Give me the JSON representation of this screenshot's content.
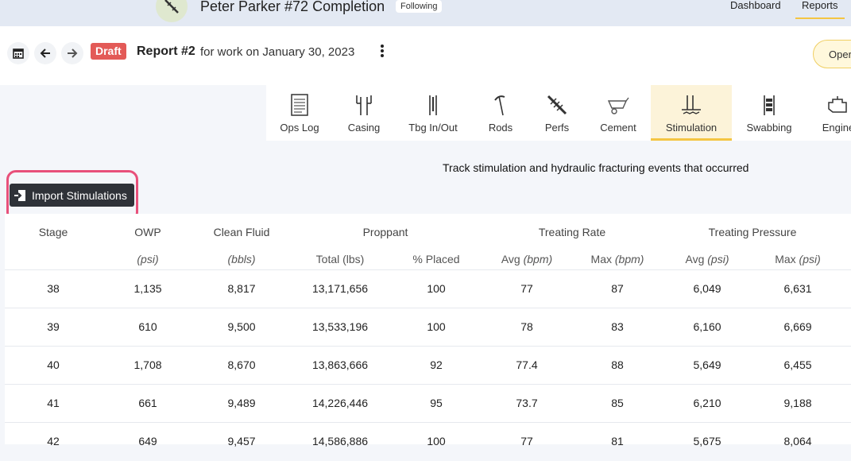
{
  "header": {
    "well_title": "Peter Parker #72 Completion",
    "follow_status": "Following",
    "nav": {
      "dashboard": "Dashboard",
      "reports": "Reports"
    }
  },
  "report": {
    "status": "Draft",
    "title": "Report #2",
    "subtitle": "for work on January 30, 2023",
    "ops_button_label": "Opera"
  },
  "tabs": [
    {
      "label": "Ops Log",
      "icon": "ops-log-icon"
    },
    {
      "label": "Casing",
      "icon": "casing-icon"
    },
    {
      "label": "Tbg In/Out",
      "icon": "tubing-icon"
    },
    {
      "label": "Rods",
      "icon": "rods-icon"
    },
    {
      "label": "Perfs",
      "icon": "perfs-icon"
    },
    {
      "label": "Cement",
      "icon": "cement-icon"
    },
    {
      "label": "Stimulation",
      "icon": "stimulation-icon",
      "active": true
    },
    {
      "label": "Swabbing",
      "icon": "swabbing-icon"
    },
    {
      "label": "Engine",
      "icon": "engine-icon"
    }
  ],
  "description": "Track stimulation and hydraulic fracturing events that occurred",
  "import_button": {
    "label": "Import Stimulations",
    "icon": "import-icon"
  },
  "table": {
    "group_headers": [
      "Stage",
      "OWP",
      "Clean Fluid",
      "Proppant",
      "Treating Rate",
      "Treating Pressure"
    ],
    "sub_headers": {
      "owp": "(psi)",
      "clean_fluid": "(bbls)",
      "proppant_total": "Total (lbs)",
      "proppant_placed": "% Placed",
      "rate_avg_label": "Avg",
      "rate_avg_unit": "(bpm)",
      "rate_max_label": "Max",
      "rate_max_unit": "(bpm)",
      "press_avg_label": "Avg",
      "press_avg_unit": "(psi)",
      "press_max_label": "Max",
      "press_max_unit": "(psi)"
    },
    "rows": [
      [
        "38",
        "1,135",
        "8,817",
        "13,171,656",
        "100",
        "77",
        "87",
        "6,049",
        "6,631"
      ],
      [
        "39",
        "610",
        "9,500",
        "13,533,196",
        "100",
        "78",
        "83",
        "6,160",
        "6,669"
      ],
      [
        "40",
        "1,708",
        "8,670",
        "13,863,666",
        "92",
        "77.4",
        "88",
        "5,649",
        "6,455"
      ],
      [
        "41",
        "661",
        "9,489",
        "14,226,446",
        "95",
        "73.7",
        "85",
        "6,210",
        "9,188"
      ],
      [
        "42",
        "649",
        "9,457",
        "14,586,886",
        "100",
        "77",
        "81",
        "5,675",
        "8,064"
      ]
    ]
  }
}
